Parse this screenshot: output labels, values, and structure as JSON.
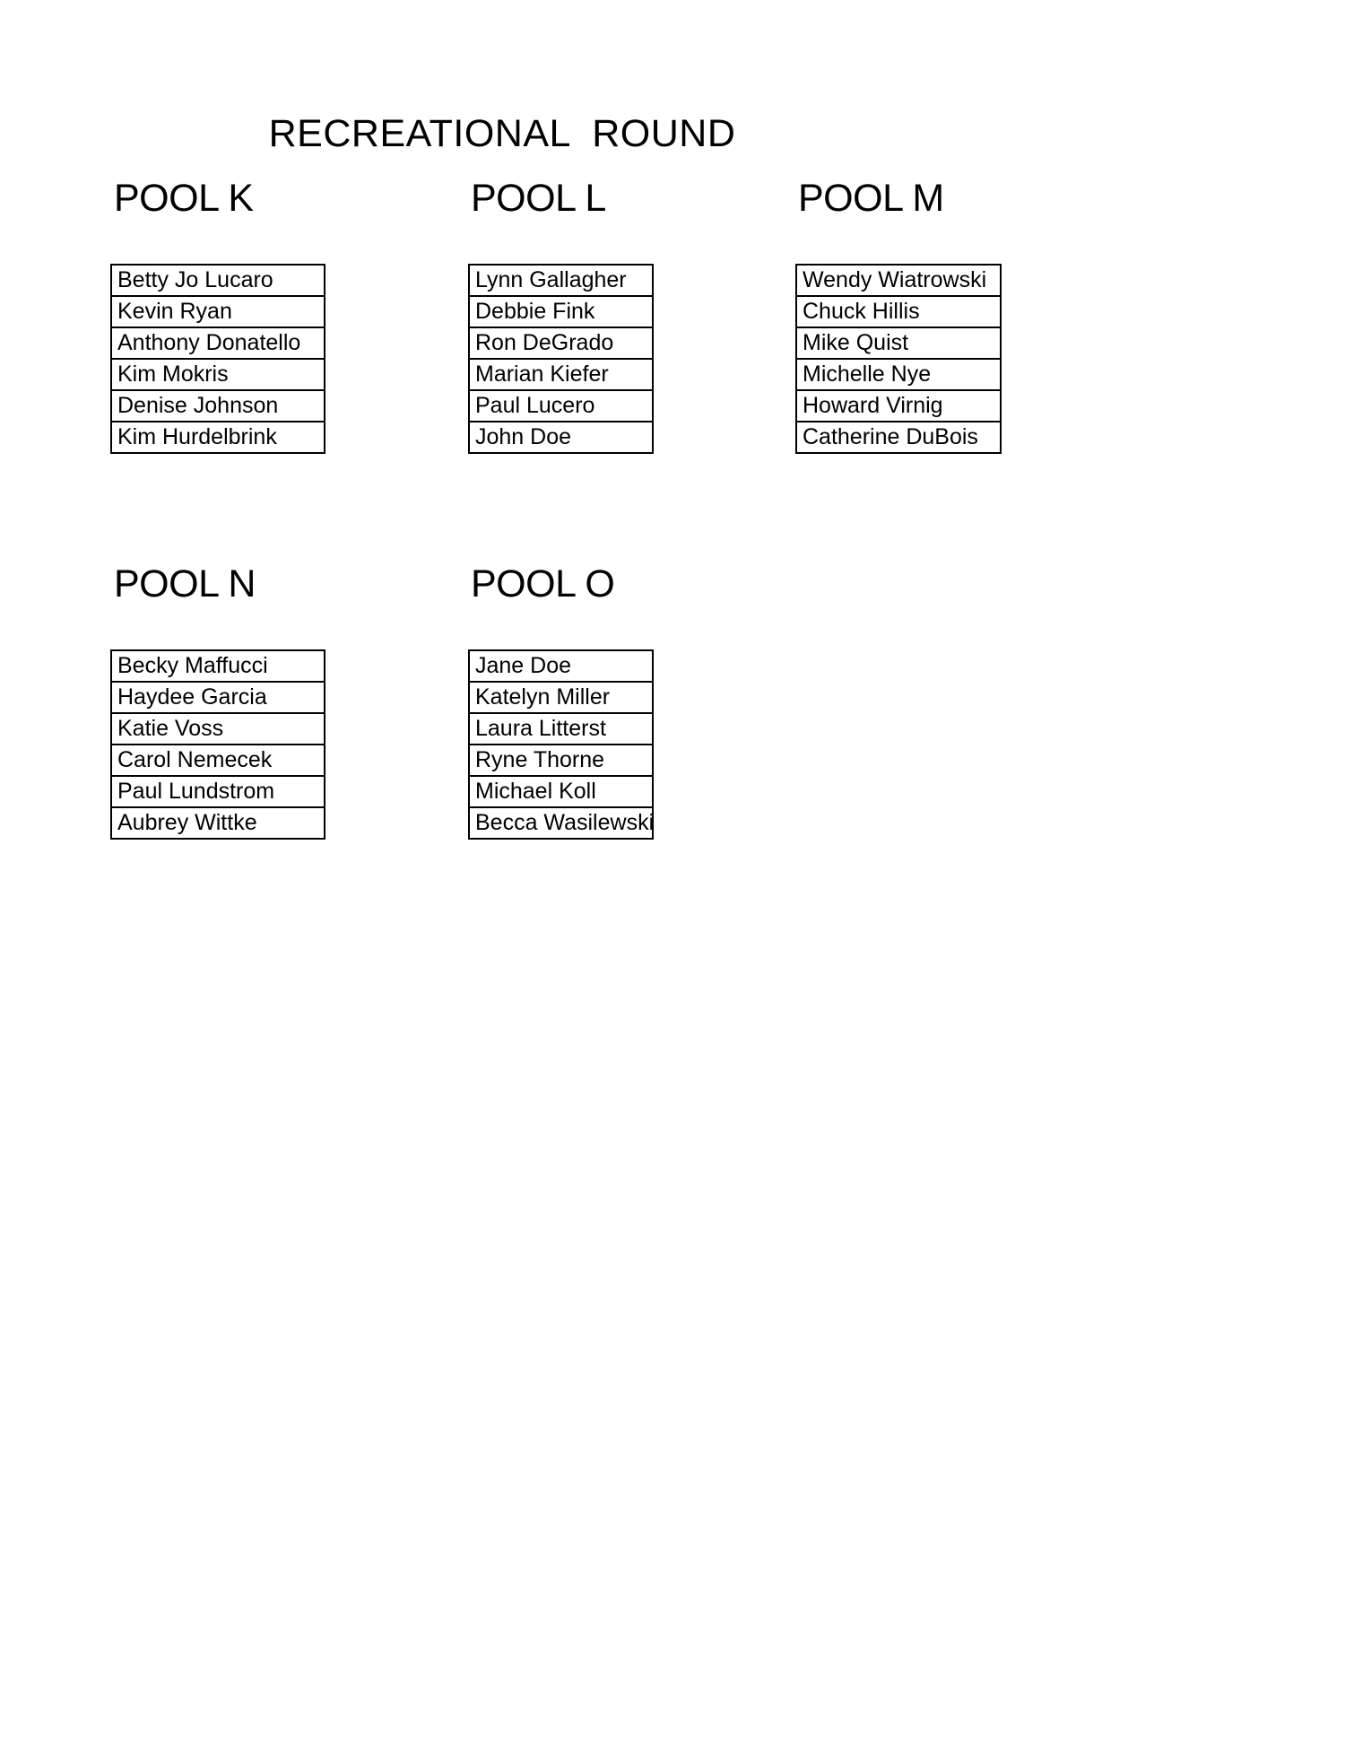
{
  "document": {
    "title": "RECREATIONAL  ROUND",
    "page_background": "#ffffff",
    "text_color": "#000000",
    "border_color": "#000000"
  },
  "pools": [
    {
      "id": "k",
      "heading": "POOL K",
      "players": [
        "Betty Jo Lucaro",
        "Kevin Ryan",
        "Anthony Donatello",
        "Kim Mokris",
        "Denise Johnson",
        "Kim Hurdelbrink"
      ]
    },
    {
      "id": "l",
      "heading": "POOL L",
      "players": [
        "Lynn Gallagher",
        "Debbie Fink",
        "Ron DeGrado",
        "Marian Kiefer",
        "Paul Lucero",
        "John Doe"
      ]
    },
    {
      "id": "m",
      "heading": "POOL M",
      "players": [
        "Wendy Wiatrowski",
        "Chuck Hillis",
        "Mike Quist",
        "Michelle Nye",
        "Howard Virnig",
        "Catherine DuBois"
      ]
    },
    {
      "id": "n",
      "heading": "POOL N",
      "players": [
        "Becky Maffucci",
        "Haydee Garcia",
        "Katie Voss",
        "Carol Nemecek",
        "Paul Lundstrom",
        "Aubrey Wittke"
      ]
    },
    {
      "id": "o",
      "heading": "POOL O",
      "players": [
        "Jane Doe",
        "Katelyn Miller",
        "Laura Litterst",
        "Ryne Thorne",
        "Michael Koll",
        "Becca Wasilewski"
      ]
    }
  ]
}
